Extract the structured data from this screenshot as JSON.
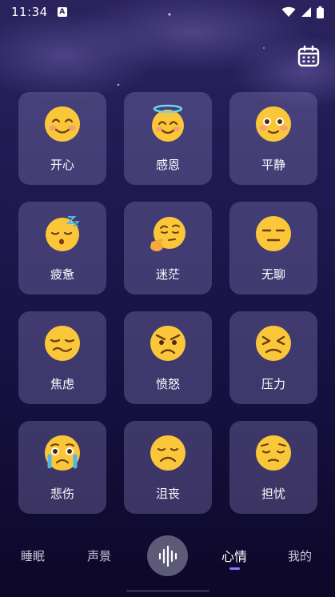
{
  "status_bar": {
    "time": "11:34",
    "notification_icon": "a-notification-icon",
    "wifi_icon": "wifi-icon",
    "signal_icon": "signal-icon",
    "battery_icon": "battery-icon"
  },
  "header": {
    "calendar_icon": "calendar-icon"
  },
  "moods": [
    {
      "label": "开心",
      "icon": "smiling-face-icon"
    },
    {
      "label": "感恩",
      "icon": "halo-face-icon"
    },
    {
      "label": "平静",
      "icon": "calm-face-icon"
    },
    {
      "label": "疲惫",
      "icon": "sleepy-face-icon"
    },
    {
      "label": "迷茫",
      "icon": "thinking-face-icon"
    },
    {
      "label": "无聊",
      "icon": "expressionless-face-icon"
    },
    {
      "label": "焦虑",
      "icon": "woozy-face-icon"
    },
    {
      "label": "愤怒",
      "icon": "angry-face-icon"
    },
    {
      "label": "压力",
      "icon": "persevering-face-icon"
    },
    {
      "label": "悲伤",
      "icon": "crying-face-icon"
    },
    {
      "label": "沮丧",
      "icon": "frowning-face-icon"
    },
    {
      "label": "担忧",
      "icon": "pensive-face-icon"
    }
  ],
  "bottom_nav": {
    "items": [
      {
        "label": "睡眠",
        "active": false
      },
      {
        "label": "声景",
        "active": false
      },
      {
        "label": "心情",
        "active": true
      },
      {
        "label": "我的",
        "active": false
      }
    ],
    "center_icon": "sound-wave-icon"
  },
  "colors": {
    "background_top": "#2b235e",
    "background_bottom": "#0d0828",
    "card": "#7870aa",
    "emoji_yellow": "#fbc73a",
    "accent": "#8a7bff"
  }
}
